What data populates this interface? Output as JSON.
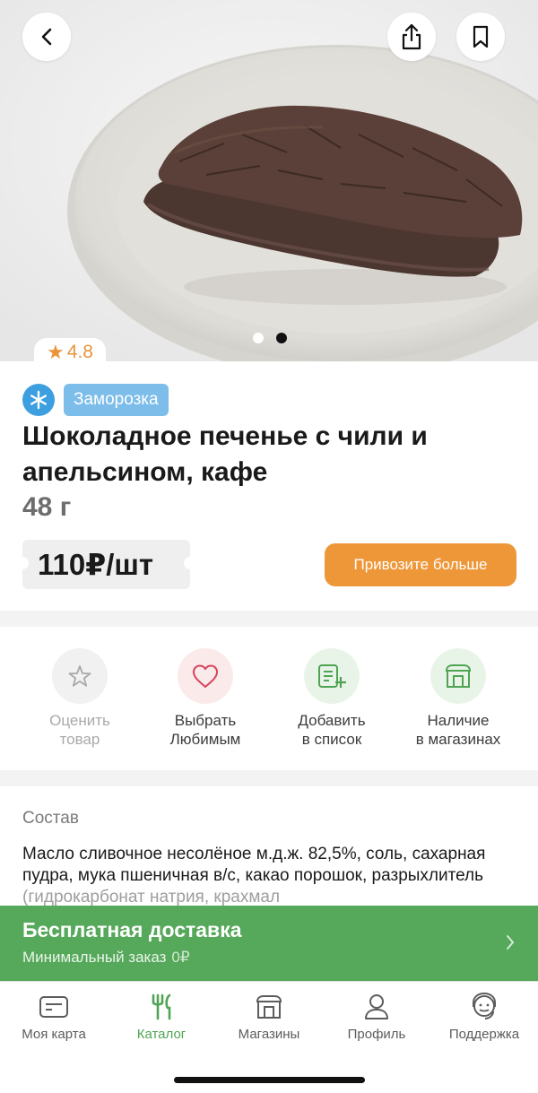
{
  "header": {
    "back_icon": "chevron-left-icon",
    "share_icon": "share-icon",
    "bookmark_icon": "bookmark-icon"
  },
  "gallery": {
    "slides": 2,
    "active_index": 1
  },
  "product": {
    "rating": "4.8",
    "tag": "Заморозка",
    "title": "Шоколадное печенье с чили и апельсином, кафе",
    "weight": "48 г",
    "price": "110₽/шт",
    "cta_label": "Привозите больше"
  },
  "actions": [
    {
      "line1": "Оценить",
      "line2": "товар",
      "icon": "star-outline-icon",
      "enabled": false
    },
    {
      "line1": "Выбрать",
      "line2": "Любимым",
      "icon": "heart-outline-icon",
      "enabled": true
    },
    {
      "line1": "Добавить",
      "line2": "в список",
      "icon": "list-add-icon",
      "enabled": true
    },
    {
      "line1": "Наличие",
      "line2": "в магазинах",
      "icon": "store-icon",
      "enabled": true
    }
  ],
  "composition": {
    "title": "Состав",
    "text": "Масло сливочное несолёное м.д.ж. 82,5%, соль, сахарная пудра, мука пшеничная в/с, какао порошок, разрыхлитель",
    "text_faded": "(гидрокарбонат натрия, крахмал"
  },
  "delivery": {
    "title": "Бесплатная доставка",
    "subtitle": "Минимальный заказ",
    "amount": "0₽"
  },
  "tabbar": [
    {
      "label": "Моя карта",
      "icon": "card-icon",
      "active": false
    },
    {
      "label": "Каталог",
      "icon": "fork-knife-icon",
      "active": true
    },
    {
      "label": "Магазины",
      "icon": "store-icon",
      "active": false
    },
    {
      "label": "Профиль",
      "icon": "person-icon",
      "active": false
    },
    {
      "label": "Поддержка",
      "icon": "support-icon",
      "active": false
    }
  ],
  "colors": {
    "accent_orange": "#ee9738",
    "frozen_blue": "#7cbde9",
    "snow_blue": "#3d9fe0",
    "brand_green": "#56a85a",
    "active_tab_green": "#4fa453"
  }
}
